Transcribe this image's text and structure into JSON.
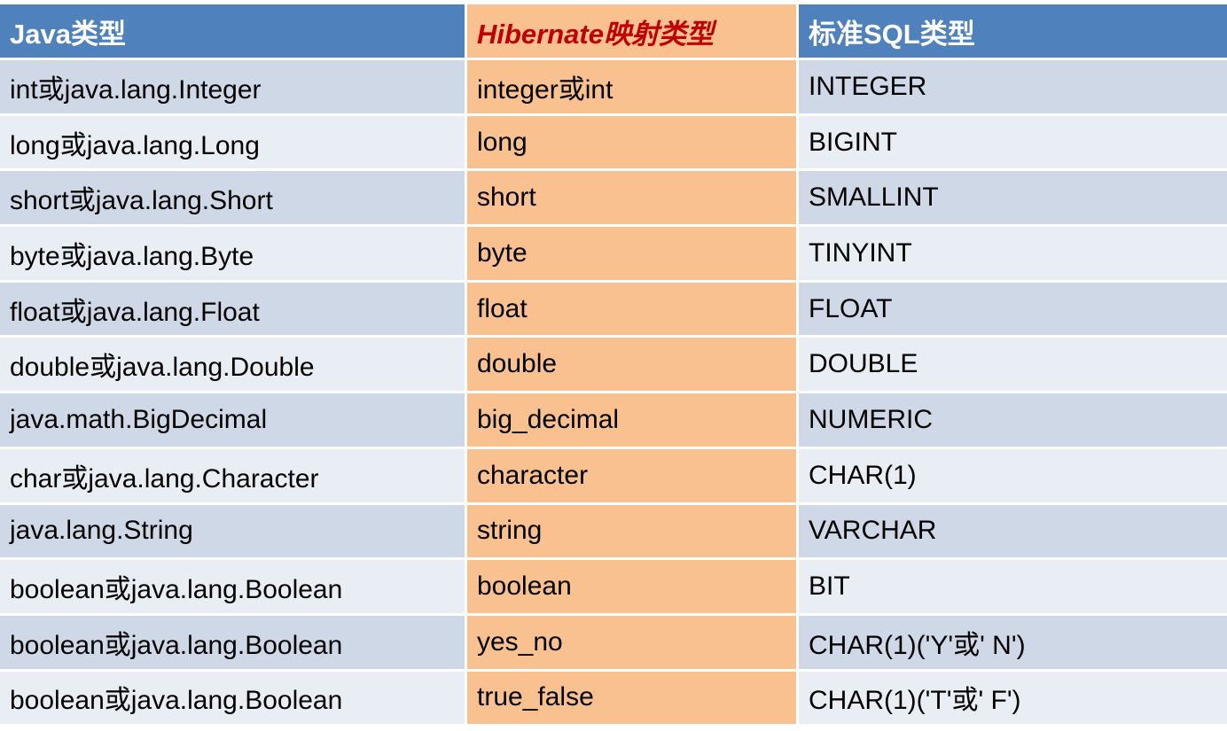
{
  "table": {
    "headers": [
      "Java类型",
      "Hibernate映射类型",
      "标准SQL类型"
    ],
    "rows": [
      [
        "int或java.lang.Integer",
        "integer或int",
        "INTEGER"
      ],
      [
        "long或java.lang.Long",
        "long",
        "BIGINT"
      ],
      [
        "short或java.lang.Short",
        "short",
        "SMALLINT"
      ],
      [
        "byte或java.lang.Byte",
        "byte",
        "TINYINT"
      ],
      [
        "float或java.lang.Float",
        "float",
        "FLOAT"
      ],
      [
        "double或java.lang.Double",
        "double",
        "DOUBLE"
      ],
      [
        "java.math.BigDecimal",
        "big_decimal",
        "NUMERIC"
      ],
      [
        "char或java.lang.Character",
        "character",
        "CHAR(1)"
      ],
      [
        "java.lang.String",
        "string",
        "VARCHAR"
      ],
      [
        "boolean或java.lang.Boolean",
        "boolean",
        "BIT"
      ],
      [
        "boolean或java.lang.Boolean",
        "yes_no",
        "CHAR(1)('Y'或' N')"
      ],
      [
        "boolean或java.lang.Boolean",
        "true_false",
        "CHAR(1)('T'或' F')"
      ]
    ]
  },
  "colors": {
    "header_blue": "#4f81bd",
    "highlight_orange": "#f9c090",
    "highlight_text_red": "#c00000",
    "row_dark": "#cfd8e7",
    "row_light": "#e9edf4"
  }
}
